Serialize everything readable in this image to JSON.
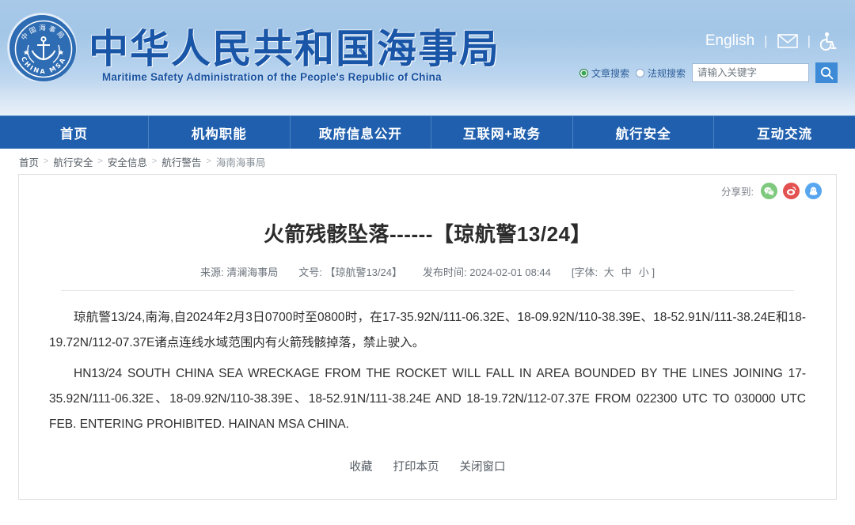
{
  "header": {
    "org_title": "中华人民共和国海事局",
    "org_subtitle": "Maritime Safety Administration of the People's Republic of China",
    "emblem": {
      "top_arc": "中国海事局",
      "bottom_arc": "CHINA MSA"
    },
    "top_links": {
      "english": "English",
      "mail_icon": "envelope-icon",
      "accessibility_icon": "wheelchair-icon",
      "separator": "|"
    },
    "search": {
      "radio_article": "文章搜索",
      "radio_regulation": "法规搜索",
      "selected": "文章搜索",
      "placeholder": "请输入关键字",
      "value": "",
      "button_icon": "search-icon"
    }
  },
  "nav": {
    "items": [
      {
        "label": "首页"
      },
      {
        "label": "机构职能"
      },
      {
        "label": "政府信息公开"
      },
      {
        "label": "互联网+政务"
      },
      {
        "label": "航行安全"
      },
      {
        "label": "互动交流"
      }
    ]
  },
  "breadcrumb": {
    "separator": ">",
    "items": [
      {
        "label": "首页"
      },
      {
        "label": "航行安全"
      },
      {
        "label": "安全信息"
      },
      {
        "label": "航行警告"
      },
      {
        "label": "海南海事局"
      }
    ]
  },
  "article": {
    "share": {
      "label": "分享到:",
      "icons": [
        {
          "name": "wechat-icon",
          "color": "#7ec97e"
        },
        {
          "name": "weibo-icon",
          "color": "#e35151"
        },
        {
          "name": "qq-icon",
          "color": "#58a6ef"
        }
      ]
    },
    "title": "火箭残骸坠落------【琼航警13/24】",
    "meta": {
      "source_label": "来源:",
      "source_value": "清澜海事局",
      "docnum_label": "文号:",
      "docnum_value": "【琼航警13/24】",
      "publish_label": "发布时间:",
      "publish_value": "2024-02-01 08:44",
      "fontsize_prefix": "[字体:",
      "fontsize_large": "大",
      "fontsize_medium": "中",
      "fontsize_small": "小",
      "fontsize_suffix": "]"
    },
    "paragraph_cn": "琼航警13/24,南海,自2024年2月3日0700时至0800时，在17-35.92N/111-06.32E、18-09.92N/110-38.39E、18-52.91N/111-38.24E和18-19.72N/112-07.37E诸点连线水域范围内有火箭残骸掉落，禁止驶入。",
    "paragraph_en": "HN13/24 SOUTH CHINA SEA WRECKAGE FROM THE ROCKET WILL FALL IN AREA BOUNDED BY THE LINES JOINING 17-35.92N/111-06.32E、18-09.92N/110-38.39E、18-52.91N/111-38.24E AND 18-19.72N/112-07.37E FROM 022300 UTC TO 030000 UTC FEB. ENTERING PROHIBITED. HAINAN MSA CHINA.",
    "footer_actions": [
      {
        "label": "收藏"
      },
      {
        "label": "打印本页"
      },
      {
        "label": "关闭窗口"
      }
    ]
  },
  "colors": {
    "nav_blue": "#1f5fae",
    "brand_blue": "#1a56a8",
    "header_sky": "#a9c9e8",
    "search_button": "#3d8ad6"
  }
}
